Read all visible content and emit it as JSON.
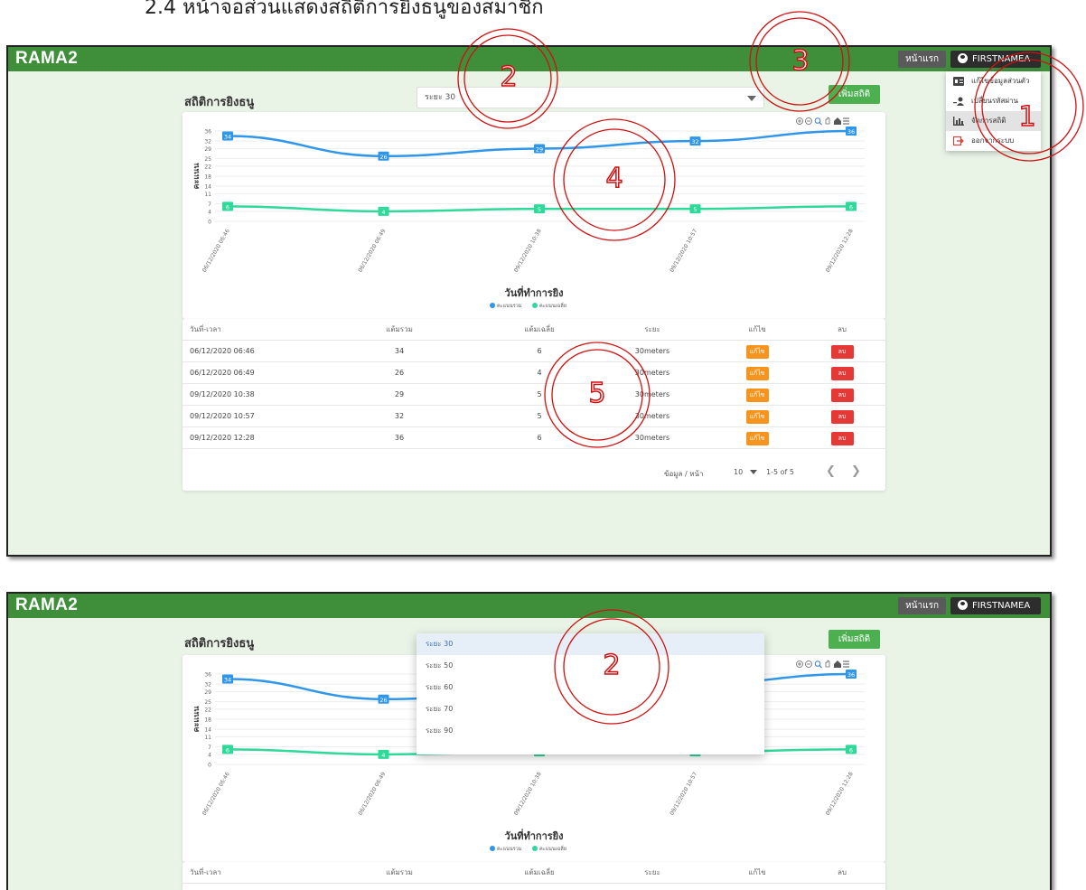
{
  "caption": "2.4 หน้าจอส่วนแสดงสถิติการยิงธนูของสมาชิก",
  "app": {
    "brand": "RAMA2",
    "home_label": "หน้าแรก",
    "user_label": "FIRSTNAMEA"
  },
  "page": {
    "title": "สถิติการยิงธนู",
    "range_selected": "ระยะ 30",
    "add_button": "เพิ่มสถิติ"
  },
  "user_menu": [
    {
      "label": "แก้ไขข้อมูลส่วนตัว",
      "icon": "id-card-icon"
    },
    {
      "label": "เปลี่ยนรหัสผ่าน",
      "icon": "user-key-icon"
    },
    {
      "label": "จัดการสถิติ",
      "icon": "bar-chart-icon"
    },
    {
      "label": "ออกจากระบบ",
      "icon": "logout-icon"
    }
  ],
  "range_options": [
    "ระยะ 30",
    "ระยะ 50",
    "ระยะ 60",
    "ระยะ 70",
    "ระยะ 90"
  ],
  "chart_data": {
    "type": "line",
    "xlabel": "วันที่ทำการยิง",
    "ylabel": "คะแนน",
    "categories": [
      "06/12/2020 06:46",
      "06/12/2020 06:49",
      "09/12/2020 10:38",
      "09/12/2020 10:57",
      "09/12/2020 12:28"
    ],
    "series": [
      {
        "name": "คะแนนรวม",
        "values": [
          34,
          26,
          29,
          32,
          36
        ],
        "color": "#2f96ea"
      },
      {
        "name": "คะแนนเฉลี่ย",
        "values": [
          6,
          4,
          5,
          5,
          6
        ],
        "color": "#2ed99a"
      }
    ],
    "yticks": [
      0,
      4,
      7,
      11,
      14,
      18,
      22,
      25,
      29,
      32,
      36
    ],
    "ylim": [
      0,
      36
    ],
    "legend": "bottom-center",
    "grid": true
  },
  "table": {
    "headers": {
      "date": "วันที่-เวลา",
      "total": "แต้มรวม",
      "avg": "แต้มเฉลี่ย",
      "range": "ระยะ",
      "edit": "แก้ไข",
      "del": "ลบ"
    },
    "rows": [
      {
        "date": "06/12/2020 06:46",
        "total": "34",
        "avg": "6",
        "range": "30meters",
        "edit": "แก้ไข",
        "del": "ลบ"
      },
      {
        "date": "06/12/2020 06:49",
        "total": "26",
        "avg": "4",
        "range": "30meters",
        "edit": "แก้ไข",
        "del": "ลบ"
      },
      {
        "date": "09/12/2020 10:38",
        "total": "29",
        "avg": "5",
        "range": "30meters",
        "edit": "แก้ไข",
        "del": "ลบ"
      },
      {
        "date": "09/12/2020 10:57",
        "total": "32",
        "avg": "5",
        "range": "30meters",
        "edit": "แก้ไข",
        "del": "ลบ"
      },
      {
        "date": "09/12/2020 12:28",
        "total": "36",
        "avg": "6",
        "range": "30meters",
        "edit": "แก้ไข",
        "del": "ลบ"
      }
    ]
  },
  "pagination": {
    "label": "ข้อมูล / หน้า",
    "per_page": "10",
    "range": "1-5 of 5"
  },
  "annotations": {
    "n1": "1",
    "n2": "2",
    "n3": "3",
    "n4": "4",
    "n5": "5",
    "color": "#d01010"
  }
}
